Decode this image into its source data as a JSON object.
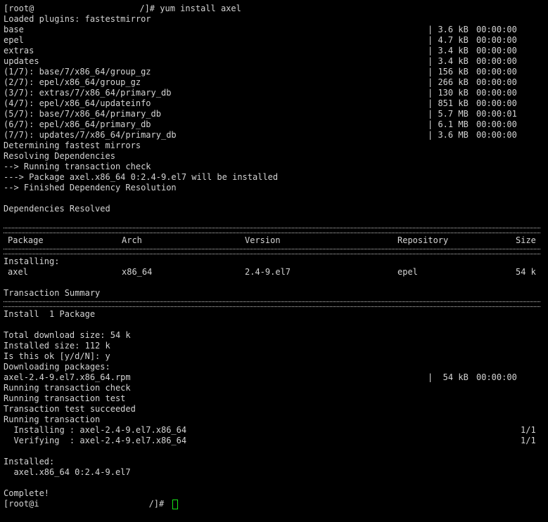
{
  "terminal": {
    "line1": {
      "prompt_start": "[root@",
      "prompt_end": "/]# ",
      "command": "yum install axel"
    },
    "line2": "Loaded plugins: fastestmirror",
    "repo_rows": [
      {
        "name": "base",
        "size": "| 3.6 kB",
        "time": "00:00:00"
      },
      {
        "name": "epel",
        "size": "| 4.7 kB",
        "time": "00:00:00"
      },
      {
        "name": "extras",
        "size": "| 3.4 kB",
        "time": "00:00:00"
      },
      {
        "name": "updates",
        "size": "| 3.4 kB",
        "time": "00:00:00"
      },
      {
        "name": "(1/7): base/7/x86_64/group_gz",
        "size": "| 156 kB",
        "time": "00:00:00"
      },
      {
        "name": "(2/7): epel/x86_64/group_gz",
        "size": "| 266 kB",
        "time": "00:00:00"
      },
      {
        "name": "(3/7): extras/7/x86_64/primary_db",
        "size": "| 130 kB",
        "time": "00:00:00"
      },
      {
        "name": "(4/7): epel/x86_64/updateinfo",
        "size": "| 851 kB",
        "time": "00:00:00"
      },
      {
        "name": "(5/7): base/7/x86_64/primary_db",
        "size": "| 5.7 MB",
        "time": "00:00:01"
      },
      {
        "name": "(6/7): epel/x86_64/primary_db",
        "size": "| 6.1 MB",
        "time": "00:00:00"
      },
      {
        "name": "(7/7): updates/7/x86_64/primary_db",
        "size": "| 3.6 MB",
        "time": "00:00:00"
      }
    ],
    "determining": "Determining fastest mirrors",
    "resolving": "Resolving Dependencies",
    "trans_check": "--> Running transaction check",
    "pkg_install": "---> Package axel.x86_64 0:2.4-9.el7 will be installed",
    "finished_dep": "--> Finished Dependency Resolution",
    "deps_resolved": "Dependencies Resolved",
    "table": {
      "headers": {
        "package": "Package",
        "arch": "Arch",
        "version": "Version",
        "repository": "Repository",
        "size": "Size"
      },
      "installing_label": "Installing:",
      "row": {
        "package": "axel",
        "arch": "x86_64",
        "version": "2.4-9.el7",
        "repository": "epel",
        "size": "54 k"
      }
    },
    "trans_summary": "Transaction Summary",
    "install_count": "Install  1 Package",
    "total_download": "Total download size: 54 k",
    "installed_size": "Installed size: 112 k",
    "is_ok": "Is this ok [y/d/N]: y",
    "downloading": "Downloading packages:",
    "rpm": {
      "name": "axel-2.4-9.el7.x86_64.rpm",
      "size": "|  54 kB",
      "time": "00:00:00"
    },
    "run_check": "Running transaction check",
    "run_test": "Running transaction test",
    "test_ok": "Transaction test succeeded",
    "run_trans": "Running transaction",
    "installing_step": {
      "text": "  Installing : axel-2.4-9.el7.x86_64",
      "progress": "1/1"
    },
    "verifying_step": {
      "text": "  Verifying  : axel-2.4-9.el7.x86_64",
      "progress": "1/1"
    },
    "installed_label": "Installed:",
    "installed_pkg": "  axel.x86_64 0:2.4-9.el7",
    "complete": "Complete!",
    "final_prompt": {
      "start": "[root@i",
      "end": "/]# "
    },
    "colors": {
      "background": "#000000",
      "text": "#d4d4d4",
      "cursor": "#19e619"
    }
  }
}
